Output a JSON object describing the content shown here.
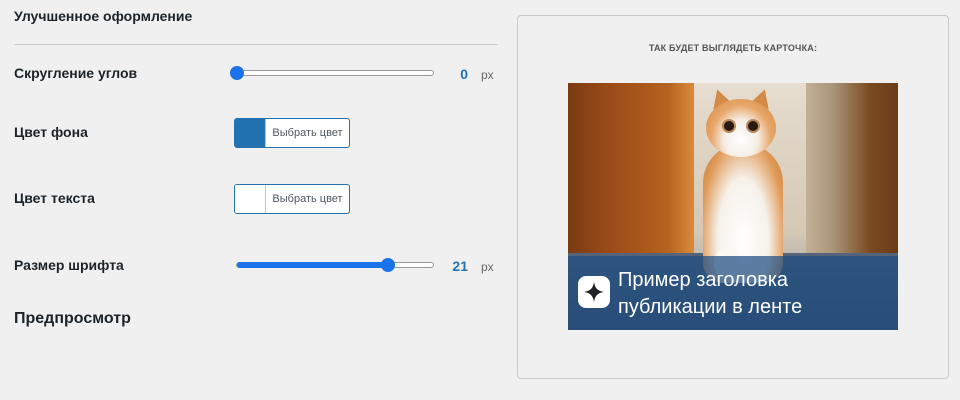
{
  "section": {
    "title": "Улучшенное оформление"
  },
  "settings": {
    "corner_radius": {
      "label": "Скругление углов",
      "value": "0",
      "unit": "px",
      "fraction": 0.0
    },
    "bg_color": {
      "label": "Цвет фона",
      "button": "Выбрать цвет",
      "swatch": "#2271b1"
    },
    "text_color": {
      "label": "Цвет текста",
      "button": "Выбрать цвет",
      "swatch": "#ffffff"
    },
    "font_size": {
      "label": "Размер шрифта",
      "value": "21",
      "unit": "px",
      "fraction": 0.77
    }
  },
  "preview": {
    "heading": "Предпросмотр",
    "caption": "ТАК БУДЕТ ВЫГЛЯДЕТЬ КАРТОЧКА:",
    "card_title": "Пример заголовка публикации в ленте",
    "badge_icon": "sparkle-icon"
  },
  "colors": {
    "accent": "#1a73e8",
    "value_text": "#2271b1"
  }
}
